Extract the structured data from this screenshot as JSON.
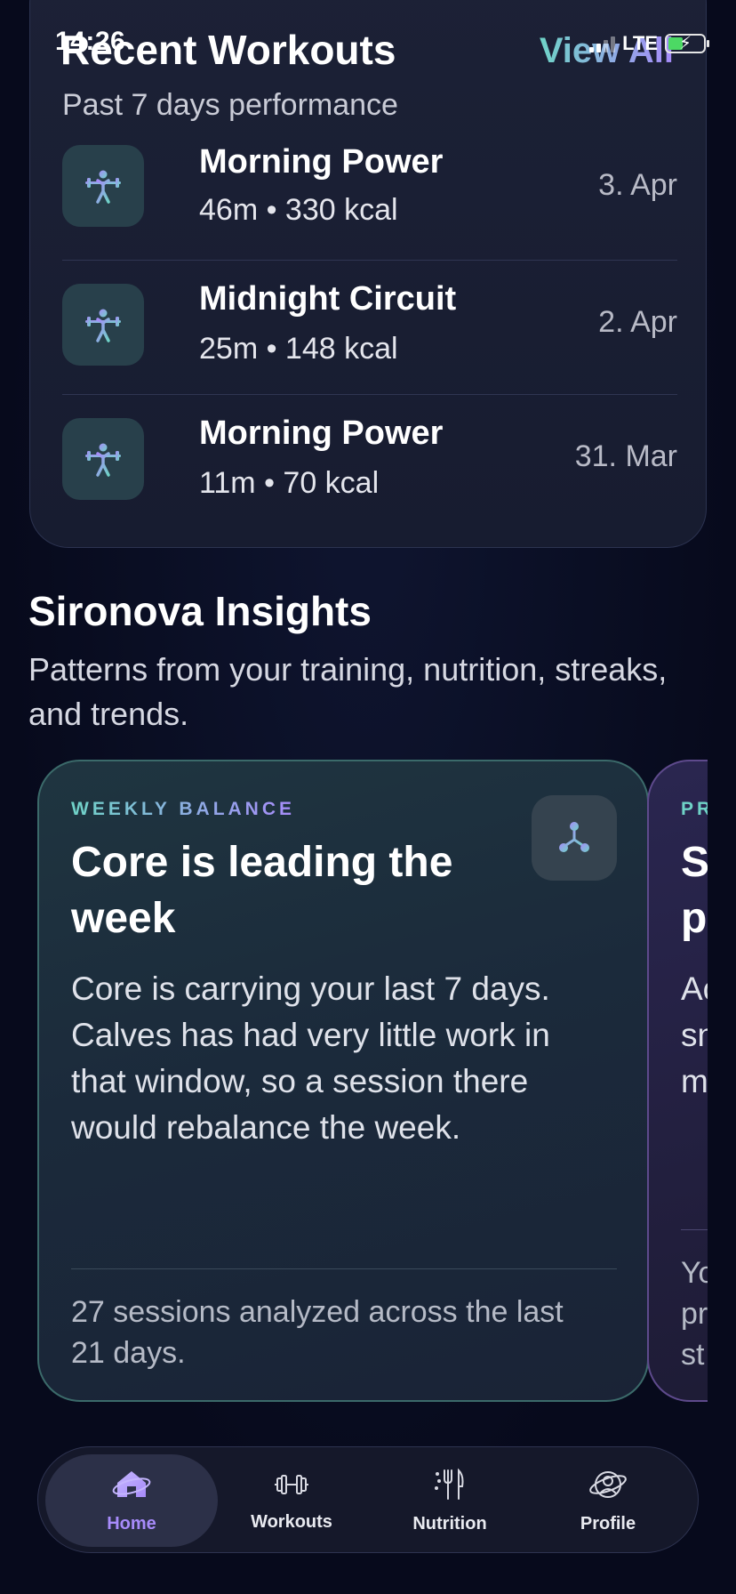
{
  "status_bar": {
    "time": "14:26",
    "network": "LTE"
  },
  "recent": {
    "title": "Recent Workouts",
    "view_all": "View All",
    "subtitle": "Past 7 days performance",
    "items": [
      {
        "name": "Morning Power",
        "meta": "46m • 330 kcal",
        "date": "3. Apr"
      },
      {
        "name": "Midnight Circuit",
        "meta": "25m • 148 kcal",
        "date": "2. Apr"
      },
      {
        "name": "Morning Power",
        "meta": "11m • 70 kcal",
        "date": "31. Mar"
      }
    ]
  },
  "insights": {
    "title": "Sironova Insights",
    "subtitle": "Patterns from your training, nutrition, streaks, and trends.",
    "cards": [
      {
        "eyebrow": "WEEKLY BALANCE",
        "headline": "Core is leading the week",
        "body": "Core is carrying your last 7 days. Calves has had very little work in that window, so a session there would rebalance the week.",
        "footer": "27 sessions analyzed across the last 21 days."
      }
    ],
    "peek": {
      "eyebrow": "PR",
      "headline_1": "S",
      "headline_2": "p",
      "body_1": "Ac",
      "body_2": "sn",
      "body_3": "m",
      "footer_1": "Yo",
      "footer_2": "pr",
      "footer_3": "st"
    }
  },
  "tabbar": {
    "tabs": [
      {
        "label": "Home",
        "icon": "home-icon"
      },
      {
        "label": "Workouts",
        "icon": "dumbbell-icon"
      },
      {
        "label": "Nutrition",
        "icon": "fork-knife-icon"
      },
      {
        "label": "Profile",
        "icon": "profile-icon"
      }
    ]
  },
  "colors": {
    "accent_teal": "#6fd3c7",
    "accent_purple": "#a78bfa",
    "background": "#070a1c",
    "card": "#1c2136"
  }
}
